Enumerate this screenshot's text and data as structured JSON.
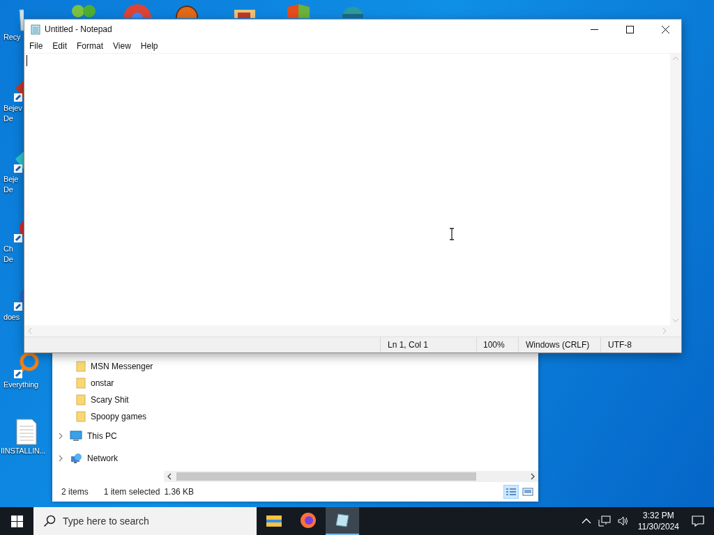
{
  "desktop": {
    "icons": [
      {
        "kind": "recycle",
        "lines": [
          "Recy"
        ]
      },
      {
        "kind": "gem",
        "lines": [
          "Bejev",
          "De"
        ]
      },
      {
        "kind": "diamond",
        "lines": [
          "Beje",
          "De"
        ]
      },
      {
        "kind": "flower",
        "lines": [
          "Ch",
          "De"
        ]
      },
      {
        "kind": "globe",
        "lines": [
          "does"
        ]
      },
      {
        "kind": "search",
        "lines": [
          "Everything"
        ]
      },
      {
        "kind": "document",
        "lines": [
          "IINSTALLIN..."
        ]
      }
    ]
  },
  "explorer": {
    "tree": [
      {
        "kind": "folder",
        "label": "MSN Messenger"
      },
      {
        "kind": "folder",
        "label": "onstar"
      },
      {
        "kind": "folder",
        "label": "Scary Shit"
      },
      {
        "kind": "folder",
        "label": "Spoopy games"
      },
      {
        "kind": "pc",
        "label": "This PC",
        "expanded": false
      },
      {
        "kind": "network",
        "label": "Network",
        "expanded": false
      }
    ],
    "status": [
      "2 items",
      "1 item selected",
      "1.36 KB"
    ],
    "views": [
      {
        "kind": "details",
        "selected": true
      },
      {
        "kind": "tiles",
        "selected": false
      }
    ]
  },
  "notepad": {
    "title": "Untitled - Notepad",
    "menu": [
      "File",
      "Edit",
      "Format",
      "View",
      "Help"
    ],
    "status": [
      "Ln 1, Col 1",
      "100%",
      "Windows (CRLF)",
      "UTF-8"
    ]
  },
  "taskbar": {
    "search": {
      "placeholder": "Type here to search"
    },
    "apps": [
      {
        "kind": "explorer",
        "active": false
      },
      {
        "kind": "firefox",
        "active": false
      },
      {
        "kind": "notepad",
        "active": true
      }
    ],
    "time": "3:32 PM",
    "date": "11/30/2024"
  }
}
